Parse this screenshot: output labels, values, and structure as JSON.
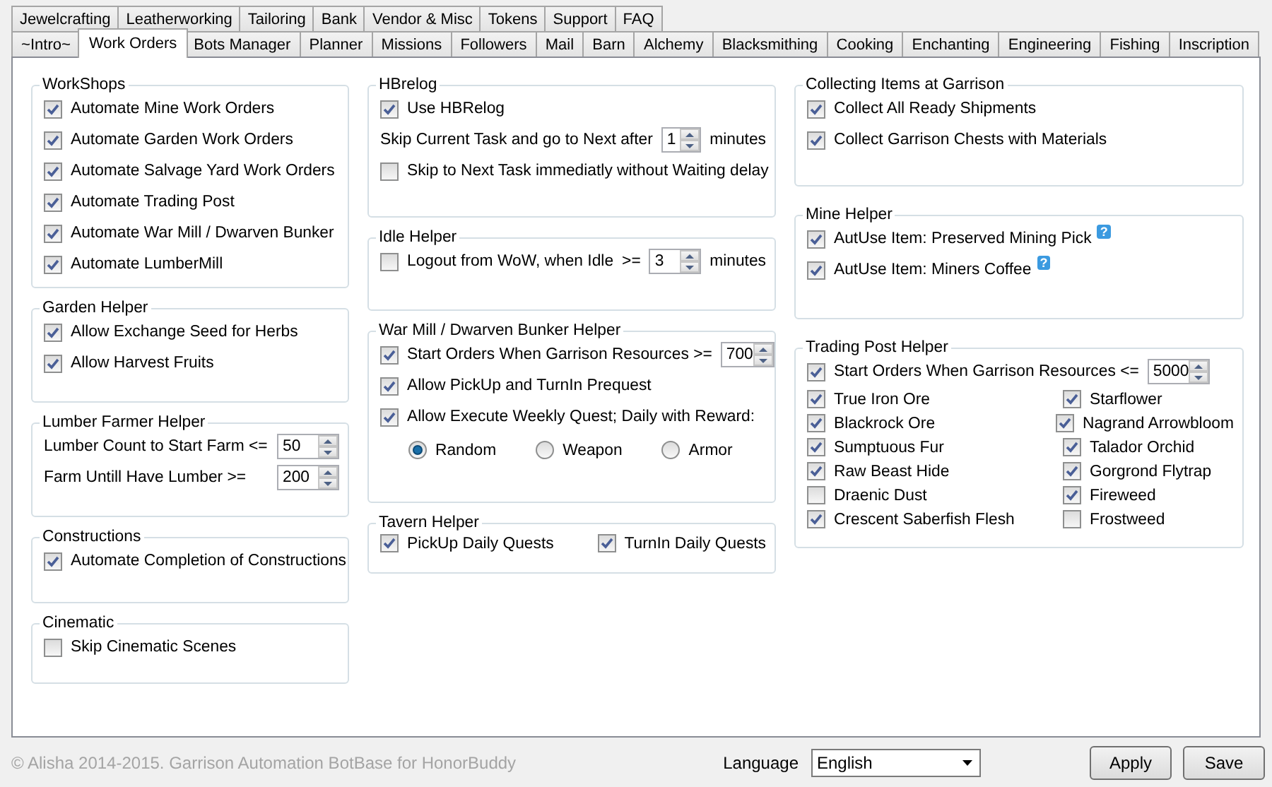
{
  "tabs_row_1": [
    {
      "label": "Jewelcrafting",
      "selected": false
    },
    {
      "label": "Leatherworking",
      "selected": false
    },
    {
      "label": "Tailoring",
      "selected": false
    },
    {
      "label": "Bank",
      "selected": false
    },
    {
      "label": "Vendor & Misc",
      "selected": false
    },
    {
      "label": "Tokens",
      "selected": false
    },
    {
      "label": "Support",
      "selected": false
    },
    {
      "label": "FAQ",
      "selected": false
    }
  ],
  "tabs_row_2": [
    {
      "label": "~Intro~",
      "selected": false
    },
    {
      "label": "Work Orders",
      "selected": true
    },
    {
      "label": "Bots Manager",
      "selected": false
    },
    {
      "label": "Planner",
      "selected": false
    },
    {
      "label": "Missions",
      "selected": false
    },
    {
      "label": "Followers",
      "selected": false
    },
    {
      "label": "Mail",
      "selected": false
    },
    {
      "label": "Barn",
      "selected": false
    },
    {
      "label": "Alchemy",
      "selected": false
    },
    {
      "label": "Blacksmithing",
      "selected": false
    },
    {
      "label": "Cooking",
      "selected": false
    },
    {
      "label": "Enchanting",
      "selected": false
    },
    {
      "label": "Engineering",
      "selected": false
    },
    {
      "label": "Fishing",
      "selected": false
    },
    {
      "label": "Inscription",
      "selected": false
    }
  ],
  "columns": [
    {
      "groups": [
        {
          "title": "WorkShops",
          "rows": [
            {
              "kind": "line",
              "items": [
                {
                  "kind": "checkbox",
                  "label": "Automate Mine Work Orders",
                  "checked": true
                }
              ]
            },
            {
              "kind": "line",
              "items": [
                {
                  "kind": "checkbox",
                  "label": "Automate Garden Work Orders",
                  "checked": true
                }
              ]
            },
            {
              "kind": "line",
              "items": [
                {
                  "kind": "checkbox",
                  "label": "Automate Salvage Yard Work Orders",
                  "checked": true
                }
              ]
            },
            {
              "kind": "line",
              "items": [
                {
                  "kind": "checkbox",
                  "label": "Automate Trading Post",
                  "checked": true
                }
              ]
            },
            {
              "kind": "line",
              "items": [
                {
                  "kind": "checkbox",
                  "label": "Automate War Mill / Dwarven Bunker",
                  "checked": true
                }
              ]
            },
            {
              "kind": "line",
              "items": [
                {
                  "kind": "checkbox",
                  "label": "Automate LumberMill",
                  "checked": true
                }
              ]
            }
          ]
        },
        {
          "title": "Garden Helper",
          "rows": [
            {
              "kind": "line",
              "items": [
                {
                  "kind": "checkbox",
                  "label": "Allow Exchange Seed for Herbs",
                  "checked": true
                }
              ]
            },
            {
              "kind": "line",
              "items": [
                {
                  "kind": "checkbox",
                  "label": "Allow Harvest Fruits",
                  "checked": true
                }
              ]
            }
          ]
        },
        {
          "title": "Lumber Farmer Helper",
          "rows": [
            {
              "kind": "form",
              "items": [
                {
                  "kind": "text",
                  "text": "Lumber Count to Start Farm <="
                },
                {
                  "kind": "spinner",
                  "value": "50"
                }
              ]
            },
            {
              "kind": "form",
              "items": [
                {
                  "kind": "text",
                  "text": "Farm Untill Have Lumber >="
                },
                {
                  "kind": "spinner",
                  "value": "200"
                }
              ]
            }
          ]
        },
        {
          "title": "Constructions",
          "rows": [
            {
              "kind": "line",
              "items": [
                {
                  "kind": "checkbox",
                  "label": "Automate Completion of Constructions",
                  "checked": true
                }
              ]
            }
          ]
        },
        {
          "title": "Cinematic",
          "rows": [
            {
              "kind": "line",
              "items": [
                {
                  "kind": "checkbox",
                  "label": "Skip Cinematic Scenes",
                  "checked": false
                }
              ]
            }
          ]
        }
      ]
    },
    {
      "groups": [
        {
          "title": "HBrelog",
          "rows": [
            {
              "kind": "line",
              "items": [
                {
                  "kind": "checkbox",
                  "label": "Use HBRelog",
                  "checked": true
                }
              ]
            },
            {
              "kind": "line",
              "items": [
                {
                  "kind": "text",
                  "text": "Skip Current Task and go to Next after"
                },
                {
                  "kind": "spinner",
                  "value": "1"
                },
                {
                  "kind": "text",
                  "text": "minutes"
                }
              ]
            },
            {
              "kind": "line",
              "items": [
                {
                  "kind": "checkbox",
                  "label": "Skip to Next Task immediatly without Waiting delay",
                  "checked": false
                }
              ]
            }
          ]
        },
        {
          "title": "Idle Helper",
          "rows": [
            {
              "kind": "line",
              "items": [
                {
                  "kind": "checkbox",
                  "label": "Logout from WoW, when Idle",
                  "checked": false
                },
                {
                  "kind": "text",
                  "text": ">="
                },
                {
                  "kind": "spinner",
                  "value": "3"
                },
                {
                  "kind": "text",
                  "text": "minutes"
                }
              ]
            }
          ]
        },
        {
          "title": "War Mill / Dwarven Bunker Helper",
          "rows": [
            {
              "kind": "line",
              "items": [
                {
                  "kind": "checkbox",
                  "label": "Start Orders When Garrison Resources >=",
                  "checked": true
                },
                {
                  "kind": "spinner",
                  "value": "700"
                }
              ]
            },
            {
              "kind": "line",
              "items": [
                {
                  "kind": "checkbox",
                  "label": "Allow PickUp and TurnIn Prequest",
                  "checked": true
                }
              ]
            },
            {
              "kind": "line",
              "items": [
                {
                  "kind": "checkbox",
                  "label": "Allow Execute Weekly Quest; Daily with Reward:",
                  "checked": true
                }
              ]
            },
            {
              "kind": "radios",
              "items": [
                {
                  "kind": "radio",
                  "label": "Random",
                  "selected": true
                },
                {
                  "kind": "radio",
                  "label": "Weapon",
                  "selected": false
                },
                {
                  "kind": "radio",
                  "label": "Armor",
                  "selected": false
                }
              ]
            }
          ]
        },
        {
          "title": "Tavern Helper",
          "rows": [
            {
              "kind": "pair",
              "items": [
                {
                  "kind": "checkbox",
                  "label": "PickUp Daily Quests",
                  "checked": true
                },
                {
                  "kind": "checkbox",
                  "label": "TurnIn Daily Quests",
                  "checked": true
                }
              ]
            }
          ]
        }
      ]
    },
    {
      "groups": [
        {
          "title": "Collecting Items at Garrison",
          "rows": [
            {
              "kind": "line",
              "items": [
                {
                  "kind": "checkbox",
                  "label": "Collect All Ready Shipments",
                  "checked": true
                }
              ]
            },
            {
              "kind": "line",
              "items": [
                {
                  "kind": "checkbox",
                  "label": "Collect Garrison Chests with Materials",
                  "checked": true
                }
              ]
            }
          ]
        },
        {
          "title": "Mine Helper",
          "rows": [
            {
              "kind": "line",
              "items": [
                {
                  "kind": "checkbox",
                  "label": "AutUse Item: Preserved Mining Pick",
                  "checked": true
                },
                {
                  "kind": "help",
                  "text": "?"
                }
              ]
            },
            {
              "kind": "line",
              "items": [
                {
                  "kind": "checkbox",
                  "label": "AutUse Item: Miners Coffee",
                  "checked": true
                },
                {
                  "kind": "help",
                  "text": "?"
                }
              ]
            }
          ]
        },
        {
          "title": "Trading Post Helper",
          "rows": [
            {
              "kind": "line",
              "items": [
                {
                  "kind": "checkbox",
                  "label": "Start Orders When Garrison Resources <=",
                  "checked": true
                },
                {
                  "kind": "spinner",
                  "value": "5000"
                }
              ]
            },
            {
              "kind": "pair",
              "items": [
                {
                  "kind": "checkbox",
                  "label": "True Iron Ore",
                  "checked": true
                },
                {
                  "kind": "checkbox",
                  "label": "Starflower",
                  "checked": true
                }
              ]
            },
            {
              "kind": "pair",
              "items": [
                {
                  "kind": "checkbox",
                  "label": "Blackrock Ore",
                  "checked": true
                },
                {
                  "kind": "checkbox",
                  "label": "Nagrand Arrowbloom",
                  "checked": true
                }
              ]
            },
            {
              "kind": "pair",
              "items": [
                {
                  "kind": "checkbox",
                  "label": "Sumptuous Fur",
                  "checked": true
                },
                {
                  "kind": "checkbox",
                  "label": "Talador Orchid",
                  "checked": true
                }
              ]
            },
            {
              "kind": "pair",
              "items": [
                {
                  "kind": "checkbox",
                  "label": "Raw Beast Hide",
                  "checked": true
                },
                {
                  "kind": "checkbox",
                  "label": "Gorgrond Flytrap",
                  "checked": true
                }
              ]
            },
            {
              "kind": "pair",
              "items": [
                {
                  "kind": "checkbox",
                  "label": "Draenic Dust",
                  "checked": false
                },
                {
                  "kind": "checkbox",
                  "label": "Fireweed",
                  "checked": true
                }
              ]
            },
            {
              "kind": "pair",
              "items": [
                {
                  "kind": "checkbox",
                  "label": "Crescent Saberfish Flesh",
                  "checked": true
                },
                {
                  "kind": "checkbox",
                  "label": "Frostweed",
                  "checked": false
                }
              ]
            }
          ]
        }
      ]
    }
  ],
  "footer": {
    "copyright": "© Alisha 2014-2015. Garrison Automation BotBase for HonorBuddy",
    "language_label": "Language",
    "language_value": "English",
    "buttons": [
      "Apply",
      "Save"
    ]
  }
}
